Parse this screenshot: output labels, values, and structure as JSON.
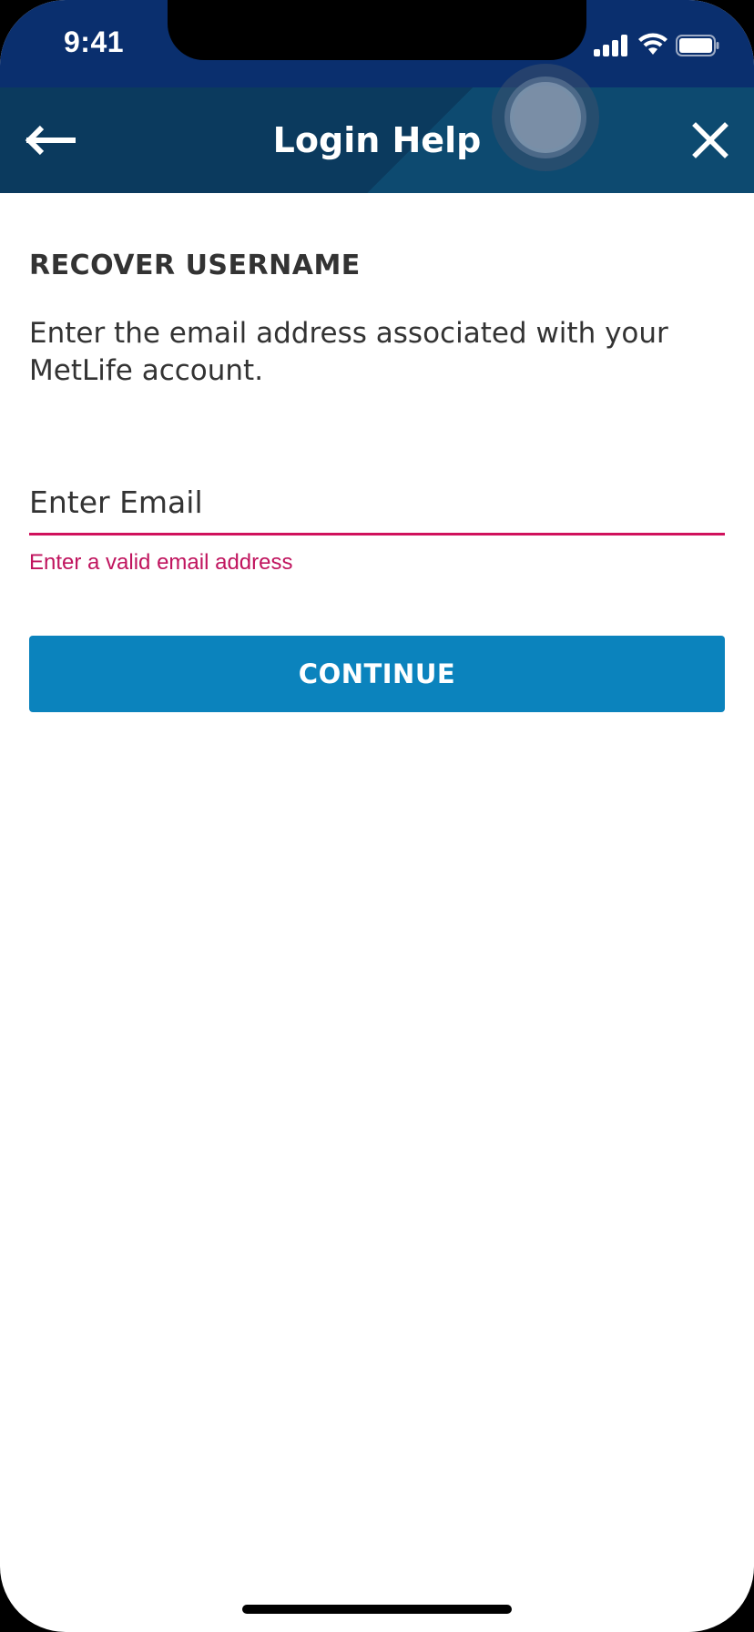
{
  "status_bar": {
    "time": "9:41",
    "icons": [
      "cellular-signal-icon",
      "wifi-icon",
      "battery-icon"
    ]
  },
  "header": {
    "title": "Login Help",
    "back_icon": "arrow-left-icon",
    "close_icon": "close-icon"
  },
  "main": {
    "section_title": "RECOVER USERNAME",
    "description": "Enter the email address associated with your MetLife account.",
    "email_input": {
      "placeholder": "Enter Email",
      "value": ""
    },
    "error_message": "Enter a valid email address",
    "continue_label": "CONTINUE"
  },
  "colors": {
    "status_bar_bg": "#0a2f6e",
    "header_bg": "#0b3a5e",
    "error": "#d0115c",
    "button_bg": "#0b83bd",
    "text": "#333333"
  }
}
